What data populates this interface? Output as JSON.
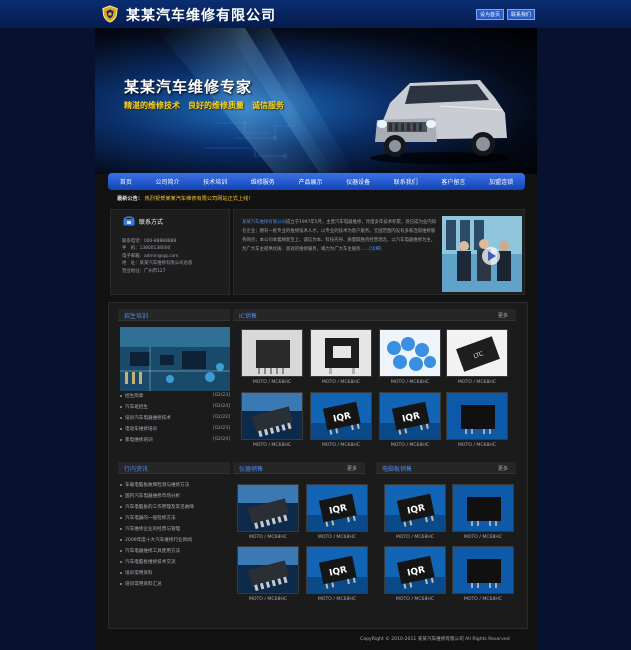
{
  "header": {
    "title": "某某汽车维修有限公司",
    "links": [
      "设为首页",
      "联系我们"
    ]
  },
  "banner": {
    "headline": "某某汽车维修专家",
    "slogans": [
      "精湛的维修技术",
      "良好的维修质量",
      "诚信服务"
    ]
  },
  "nav": {
    "items": [
      "首页",
      "公司简介",
      "技术培训",
      "维修服务",
      "产品展示",
      "仪器设备",
      "联系我们",
      "客户留言",
      "加盟连锁"
    ]
  },
  "notice": {
    "label": "最新公告：",
    "text": "热烈祝贺某某汽车维修有限公司网站正式上线！"
  },
  "contact": {
    "title": "联系方式",
    "lines": [
      "联系电话：000-88888888",
      "手　机：13800138000",
      "电子邮箱：admin@qq.com",
      "地　址：某某汽车维修有限公司总部",
      "营业地址：广州市127"
    ]
  },
  "about": {
    "company": "某某汽车维修有限公司",
    "text": "成立于1997年5月，主营汽车电器维修，凭借多年技术积累，现已成为业内知名企业；拥有一批专业的维修技术人才，以专业的技术为客户服务，全国范围内设有多家连锁维修服务网点；本公司本着顾客至上、诚信为本、科技先导、质量取胜的经营理念，以汽车电器维修为主，为广大车主提供优质、高效的维修服务，竭力为广大车主服务……",
    "more": "[详细]"
  },
  "sections": {
    "news": {
      "title": "招生培训"
    },
    "products": {
      "title": "IC销售",
      "more": "更多"
    },
    "industry": {
      "title": "行内资讯"
    },
    "instruments": {
      "title": "仪器销售",
      "more": "更多"
    },
    "computers": {
      "title": "电脑板销售",
      "more": "更多"
    }
  },
  "news_items": [
    {
      "text": "招生简章",
      "date": "[02/23]"
    },
    {
      "text": "汽车班招生",
      "date": "[02/24]"
    },
    {
      "text": "培训汽车电器维修技术",
      "date": "[02/22]"
    },
    {
      "text": "电动车维修培训",
      "date": "[02/23]"
    },
    {
      "text": "家电维修培训",
      "date": "[02/24]"
    }
  ],
  "industry_items": [
    "车载电脑板故障检测与维修方法",
    "国内汽车电器维修市场分析",
    "汽车电脑板的工作原理及常见故障",
    "汽车电器的一般检修方法",
    "汽车维修企业的经营与管理",
    "2009年度十大汽车维修行业新闻",
    "汽车电器维修工具使用方法",
    "汽车电脑板维修技术交流",
    "培训常用资料",
    "培训常用资料汇总"
  ],
  "product_caption": "MOTO / MC68HC",
  "footer": {
    "text": "CopyRight © 2010-2011 某某汽车维修有限公司 All Rights Reserved"
  },
  "colors": {
    "accent": "#4d8af0",
    "nav": "#1f56c8",
    "notice": "#f0c630",
    "slogan": "#f5d020"
  }
}
